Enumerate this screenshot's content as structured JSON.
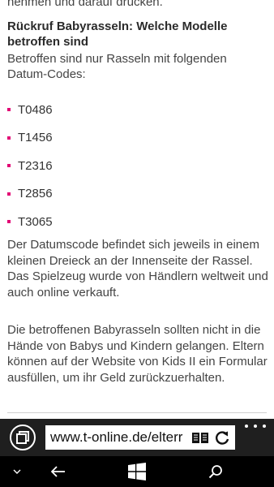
{
  "article": {
    "top_cut_text": "nehmen und darauf drücken.",
    "heading": "Rückruf Babyrasseln: Welche Modelle betroffen sind",
    "intro": "Betroffen sind nur Rasseln mit folgenden Datum-Codes:",
    "codes": [
      "T0486",
      "T1456",
      "T2316",
      "T2856",
      "T3065"
    ],
    "paragraph_1": "Der Datumscode befindet sich jeweils in einem kleinen Dreieck an der Innenseite der Rassel. Das Spielzeug wurde von Händlern weltweit und auch online verkauft.",
    "paragraph_2": "Die betroffenen Babyrasseln sollten nicht in die Hände von Babys und Kindern gelangen. Eltern können auf der Website von Kids II ein Formular ausfüllen, um ihr Geld zurückzuerhalten."
  },
  "browser": {
    "url": "www.t-online.de/elterr",
    "icons": [
      "tabs-icon",
      "reading-view-icon",
      "refresh-icon",
      "more-icon"
    ]
  },
  "system_nav": {
    "icons": [
      "chevron-down-icon",
      "back-arrow-icon",
      "windows-icon",
      "search-icon"
    ]
  },
  "colors": {
    "bullet": "#e20074",
    "address_bar_bg": "#1f1f1f",
    "nav_bar_bg": "#000000"
  }
}
